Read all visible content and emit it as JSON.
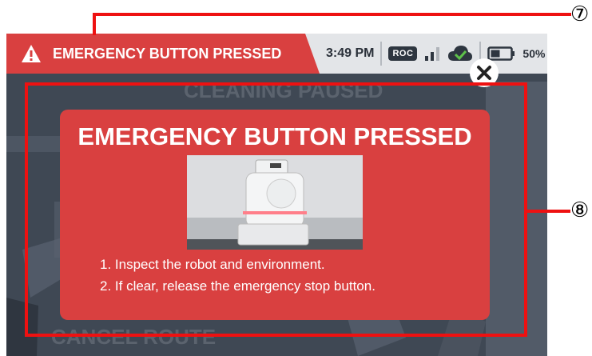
{
  "status_bar": {
    "alert_text": "EMERGENCY BUTTON PRESSED",
    "time": "3:49 PM",
    "network_badge": "ROC",
    "battery_percent": "50%",
    "battery_level": 0.5,
    "signal_level": 2,
    "cloud_status": "connected"
  },
  "background": {
    "status_text": "CLEANING PAUSED",
    "cancel_route_label": "CANCEL ROUTE"
  },
  "dialog": {
    "title": "EMERGENCY BUTTON PRESSED",
    "steps": [
      "1. Inspect the robot and environment.",
      "2. If clear, release the emergency stop button."
    ]
  },
  "annotations": {
    "label_7": "⑦",
    "label_8": "⑧"
  },
  "colors": {
    "alert_red": "#d94040",
    "annotation_red": "#ee1111",
    "cloud_green": "#5ec24a"
  }
}
